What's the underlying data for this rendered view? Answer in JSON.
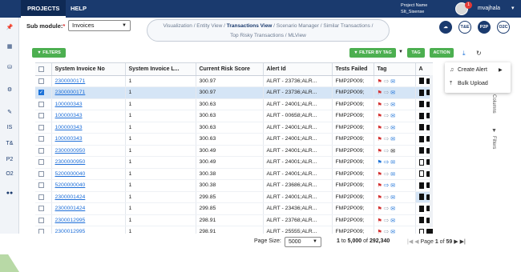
{
  "header": {
    "tabs": [
      "PROJECTS",
      "HELP"
    ],
    "project_name_label": "Project Name",
    "project_name": "SIt_Sisense",
    "notification_count": "1",
    "username": "mvajhala"
  },
  "sidebar": {
    "labels": [
      "IS",
      "T&",
      "P2",
      "O2"
    ]
  },
  "submodule": {
    "label": "Sub module:",
    "required_mark": "*",
    "value": "Invoices"
  },
  "views": {
    "line1_before": "Visualization / Entity View / ",
    "line1_active": "Transactions View",
    "line1_after": " / Scenario Manager / Similar Transactions /",
    "line2": "Top Risky Transactions / MLView"
  },
  "circle_buttons": [
    "T&E",
    "P2P",
    "O2C"
  ],
  "toolbar": {
    "filters": "FILTERS",
    "filter_by_tag": "FILTER BY TAG",
    "tag": "TAG",
    "action": "ACTION"
  },
  "popup_menu": {
    "items": [
      "Create Alert",
      "Bulk Upload"
    ]
  },
  "grid": {
    "columns": [
      "System Invoice No",
      "System Invoice L...",
      "Current Risk Score",
      "Alert Id",
      "Tests Failed",
      "Tag",
      "A"
    ],
    "rows": [
      {
        "invoice": "2300000171",
        "line": "1",
        "score": "300.97",
        "alert": "ALRT - 23736;ALR...",
        "tests": "FMP2P009;"
      },
      {
        "invoice": "2300000171",
        "line": "1",
        "score": "300.97",
        "alert": "ALRT - 23736;ALR...",
        "tests": "FMP2P009;"
      },
      {
        "invoice": "100000343",
        "line": "1",
        "score": "300.63",
        "alert": "ALRT - 24001;ALR...",
        "tests": "FMP2P009;"
      },
      {
        "invoice": "100000343",
        "line": "1",
        "score": "300.63",
        "alert": "ALRT - 00658;ALR...",
        "tests": "FMP2P009;"
      },
      {
        "invoice": "100000343",
        "line": "1",
        "score": "300.63",
        "alert": "ALRT - 24001;ALR...",
        "tests": "FMP2P009;"
      },
      {
        "invoice": "100000343",
        "line": "1",
        "score": "300.63",
        "alert": "ALRT - 24001;ALR...",
        "tests": "FMP2P009;"
      },
      {
        "invoice": "2300000950",
        "line": "1",
        "score": "300.49",
        "alert": "ALRT - 24001;ALR...",
        "tests": "FMP2P009;"
      },
      {
        "invoice": "2300000950",
        "line": "1",
        "score": "300.49",
        "alert": "ALRT - 24001;ALR...",
        "tests": "FMP2P009;"
      },
      {
        "invoice": "5200000040",
        "line": "1",
        "score": "300.38",
        "alert": "ALRT - 24001;ALR...",
        "tests": "FMP2P009;"
      },
      {
        "invoice": "5200000040",
        "line": "1",
        "score": "300.38",
        "alert": "ALRT - 23686;ALR...",
        "tests": "FMP2P009;"
      },
      {
        "invoice": "2300001424",
        "line": "1",
        "score": "299.85",
        "alert": "ALRT - 24001;ALR...",
        "tests": "FMP2P009;"
      },
      {
        "invoice": "2300001424",
        "line": "1",
        "score": "299.85",
        "alert": "ALRT - 23436;ALR...",
        "tests": "FMP2P009;"
      },
      {
        "invoice": "2300012995",
        "line": "1",
        "score": "298.91",
        "alert": "ALRT - 23768;ALR...",
        "tests": "FMP2P009;"
      },
      {
        "invoice": "2300012995",
        "line": "1",
        "score": "298.91",
        "alert": "ALRT - 25555;ALR...",
        "tests": "FMP2P009;"
      }
    ]
  },
  "side_labels": [
    "Columns",
    "Filters"
  ],
  "footer": {
    "page_size_label": "Page Size:",
    "page_size": "5000",
    "range_from": "1",
    "range_to": "5,000",
    "range_of": "of",
    "range_total": "292,340",
    "range_to_word": "to",
    "page_label": "Page",
    "page_current": "1",
    "page_of": "of",
    "page_total": "59"
  }
}
